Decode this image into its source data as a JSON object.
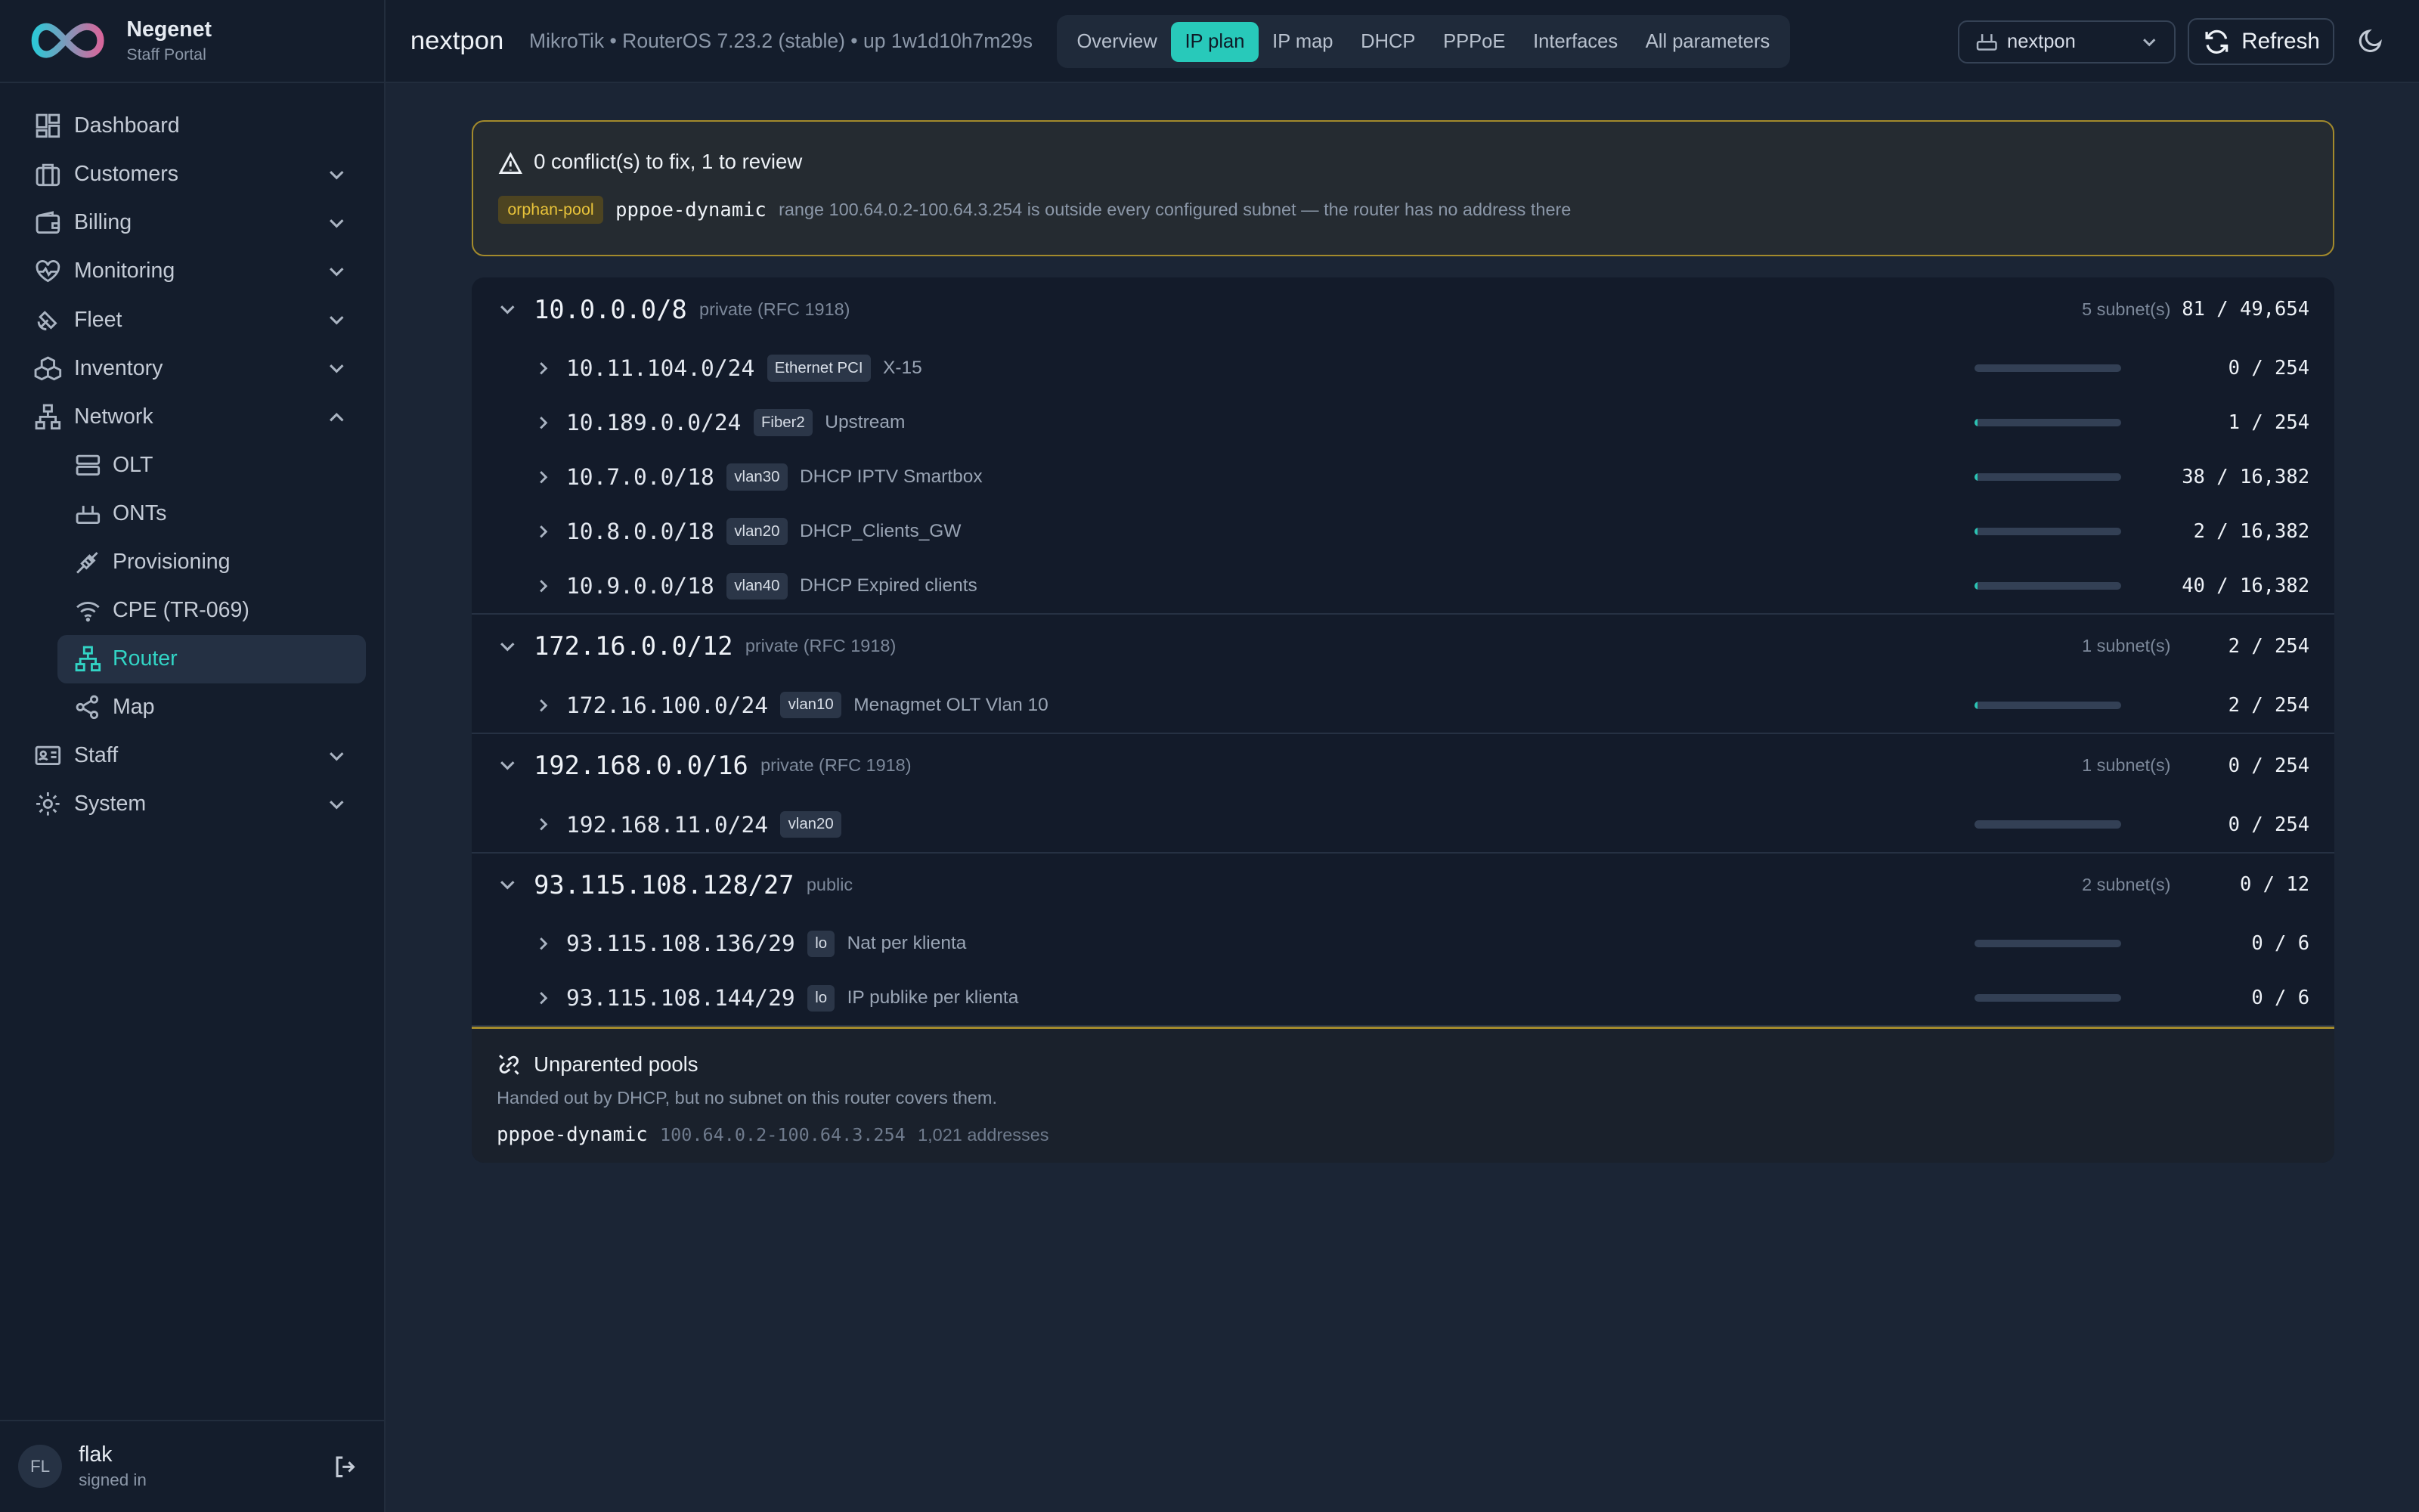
{
  "brand": {
    "name": "Negenet",
    "subtitle": "Staff Portal"
  },
  "sidebar": {
    "items": [
      {
        "label": "Dashboard",
        "icon": "dashboard-icon",
        "expandable": false
      },
      {
        "label": "Customers",
        "icon": "briefcase-icon",
        "expandable": true
      },
      {
        "label": "Billing",
        "icon": "wallet-icon",
        "expandable": true
      },
      {
        "label": "Monitoring",
        "icon": "heart-pulse-icon",
        "expandable": true
      },
      {
        "label": "Fleet",
        "icon": "satellite-icon",
        "expandable": true
      },
      {
        "label": "Inventory",
        "icon": "boxes-icon",
        "expandable": true
      },
      {
        "label": "Network",
        "icon": "network-icon",
        "expandable": true,
        "expanded": true
      }
    ],
    "network_children": [
      {
        "label": "OLT",
        "icon": "server-icon"
      },
      {
        "label": "ONTs",
        "icon": "router-device-icon"
      },
      {
        "label": "Provisioning",
        "icon": "plug-icon"
      },
      {
        "label": "CPE (TR-069)",
        "icon": "wifi-icon"
      },
      {
        "label": "Router",
        "icon": "network-icon",
        "active": true
      },
      {
        "label": "Map",
        "icon": "share-icon"
      }
    ],
    "bottom_items": [
      {
        "label": "Staff",
        "icon": "id-card-icon",
        "expandable": true
      },
      {
        "label": "System",
        "icon": "gear-icon",
        "expandable": true
      }
    ]
  },
  "user": {
    "initials": "FL",
    "name": "flak",
    "status": "signed in"
  },
  "header": {
    "title": "nextpon",
    "subtitle": "MikroTik • RouterOS 7.23.2 (stable) • up 1w1d10h7m29s",
    "tabs": [
      "Overview",
      "IP plan",
      "IP map",
      "DHCP",
      "PPPoE",
      "Interfaces",
      "All parameters"
    ],
    "active_tab": "IP plan",
    "router_select": "nextpon",
    "refresh_label": "Refresh"
  },
  "alert": {
    "title": "0 conflict(s) to fix, 1 to review",
    "tag": "orphan-pool",
    "pool": "pppoe-dynamic",
    "message": "range 100.64.0.2-100.64.3.254 is outside every configured subnet — the router has no address there"
  },
  "blocks": [
    {
      "cidr": "10.0.0.0/8",
      "scope": "private (RFC 1918)",
      "count": "5 subnet(s)",
      "usage": "81 / 49,654",
      "subnets": [
        {
          "cidr": "10.11.104.0/24",
          "iface": "Ethernet PCI",
          "name": "X-15",
          "usage": "0 / 254",
          "fill": 0.0
        },
        {
          "cidr": "10.189.0.0/24",
          "iface": "Fiber2",
          "name": "Upstream",
          "usage": "1 / 254",
          "fill": 0.0039
        },
        {
          "cidr": "10.7.0.0/18",
          "iface": "vlan30",
          "name": "DHCP IPTV Smartbox",
          "usage": "38 / 16,382",
          "fill": 0.0023
        },
        {
          "cidr": "10.8.0.0/18",
          "iface": "vlan20",
          "name": "DHCP_Clients_GW",
          "usage": "2 / 16,382",
          "fill": 0.0001
        },
        {
          "cidr": "10.9.0.0/18",
          "iface": "vlan40",
          "name": "DHCP Expired clients",
          "usage": "40 / 16,382",
          "fill": 0.0024
        }
      ]
    },
    {
      "cidr": "172.16.0.0/12",
      "scope": "private (RFC 1918)",
      "count": "1 subnet(s)",
      "usage": "2 / 254",
      "subnets": [
        {
          "cidr": "172.16.100.0/24",
          "iface": "vlan10",
          "name": "Menagmet OLT Vlan 10",
          "usage": "2 / 254",
          "fill": 0.0079
        }
      ]
    },
    {
      "cidr": "192.168.0.0/16",
      "scope": "private (RFC 1918)",
      "count": "1 subnet(s)",
      "usage": "0 / 254",
      "subnets": [
        {
          "cidr": "192.168.11.0/24",
          "iface": "vlan20",
          "name": "",
          "usage": "0 / 254",
          "fill": 0.0
        }
      ]
    },
    {
      "cidr": "93.115.108.128/27",
      "scope": "public",
      "count": "2 subnet(s)",
      "usage": "0 / 12",
      "subnets": [
        {
          "cidr": "93.115.108.136/29",
          "iface": "lo",
          "name": "Nat per klienta",
          "usage": "0 / 6",
          "fill": 0.0
        },
        {
          "cidr": "93.115.108.144/29",
          "iface": "lo",
          "name": "IP publike per klienta",
          "usage": "0 / 6",
          "fill": 0.0
        }
      ]
    }
  ],
  "unparented": {
    "title": "Unparented pools",
    "description": "Handed out by DHCP, but no subnet on this router covers them.",
    "pool": "pppoe-dynamic",
    "range": "100.64.0.2-100.64.3.254",
    "count": "1,021 addresses"
  },
  "colors": {
    "accent": "#28c9ba",
    "warning": "#a38a2c",
    "background": "#1b2535",
    "sidebar": "#141d2c"
  }
}
